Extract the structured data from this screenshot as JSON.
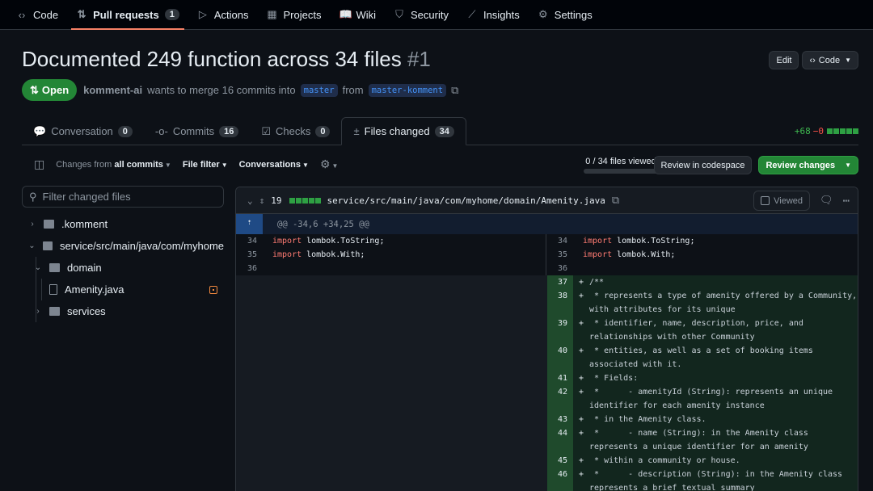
{
  "nav": [
    {
      "icon": "code-icon",
      "glyph": "‹›",
      "label": "Code"
    },
    {
      "icon": "git-pull-request-icon",
      "glyph": "⇅",
      "label": "Pull requests",
      "count": "1",
      "active": true
    },
    {
      "icon": "play-icon",
      "glyph": "▷",
      "label": "Actions"
    },
    {
      "icon": "table-icon",
      "glyph": "▦",
      "label": "Projects"
    },
    {
      "icon": "book-icon",
      "glyph": "📖",
      "label": "Wiki"
    },
    {
      "icon": "shield-icon",
      "glyph": "⛉",
      "label": "Security"
    },
    {
      "icon": "graph-icon",
      "glyph": "⟋",
      "label": "Insights"
    },
    {
      "icon": "gear-icon",
      "glyph": "⚙",
      "label": "Settings"
    }
  ],
  "pr": {
    "title": "Documented 249 function across 34 files",
    "number": "#1",
    "state": "Open",
    "author": "komment-ai",
    "merge_text": "wants to merge 16 commits into",
    "base": "master",
    "from_text": "from",
    "head": "master-komment",
    "edit": "Edit",
    "code": "Code"
  },
  "tabs": [
    {
      "label": "Conversation",
      "count": "0",
      "icon": "comment-icon",
      "glyph": "💬"
    },
    {
      "label": "Commits",
      "count": "16",
      "icon": "commit-icon",
      "glyph": "-o-"
    },
    {
      "label": "Checks",
      "count": "0",
      "icon": "checklist-icon",
      "glyph": "☑"
    },
    {
      "label": "Files changed",
      "count": "34",
      "icon": "file-diff-icon",
      "glyph": "±",
      "active": true
    }
  ],
  "diffstat": {
    "additions": "+68",
    "deletions": "−0"
  },
  "toolbar": {
    "changes_prefix": "Changes from",
    "changes_value": "all commits",
    "file_filter": "File filter",
    "conversations": "Conversations"
  },
  "review": {
    "viewed": "0 / 34 files viewed",
    "viewed_fraction": 0,
    "codespace": "Review in codespace",
    "changes": "Review changes"
  },
  "filter": {
    "placeholder": "Filter changed files"
  },
  "tree": [
    {
      "type": "folder",
      "label": ".komment",
      "expanded": false
    },
    {
      "type": "folder",
      "label": "service/src/main/java/com/myhome",
      "expanded": true
    },
    {
      "type": "folder",
      "label": "domain",
      "expanded": true
    },
    {
      "type": "file",
      "label": "Amenity.java",
      "status": "modified"
    },
    {
      "type": "folder",
      "label": "services",
      "expanded": false
    }
  ],
  "file": {
    "changes": "19",
    "path": "service/src/main/java/com/myhome/domain/Amenity.java",
    "viewed": "Viewed",
    "hunk": "@@ -34,6 +34,25 @@"
  },
  "context": [
    {
      "num": "34",
      "kw": "import",
      "text": " lombok.ToString;"
    },
    {
      "num": "35",
      "kw": "import",
      "text": " lombok.With;"
    },
    {
      "num": "36",
      "kw": "",
      "text": ""
    }
  ],
  "added": [
    {
      "num": "37",
      "text": "/**"
    },
    {
      "num": "38",
      "text": " * represents a type of amenity offered by a Community, with attributes for its unique"
    },
    {
      "num": "39",
      "text": " * identifier, name, description, price, and relationships with other Community"
    },
    {
      "num": "40",
      "text": " * entities, as well as a set of booking items associated with it."
    },
    {
      "num": "41",
      "text": " * Fields:"
    },
    {
      "num": "42",
      "text": " *      - amenityId (String): represents an unique identifier for each amenity instance"
    },
    {
      "num": "43",
      "text": " * in the Amenity class."
    },
    {
      "num": "44",
      "text": " *      - name (String): in the Amenity class represents a unique identifier for an amenity"
    },
    {
      "num": "45",
      "text": " * within a community or house."
    },
    {
      "num": "46",
      "text": " *      - description (String): in the Amenity class represents a brief textual summary"
    }
  ]
}
